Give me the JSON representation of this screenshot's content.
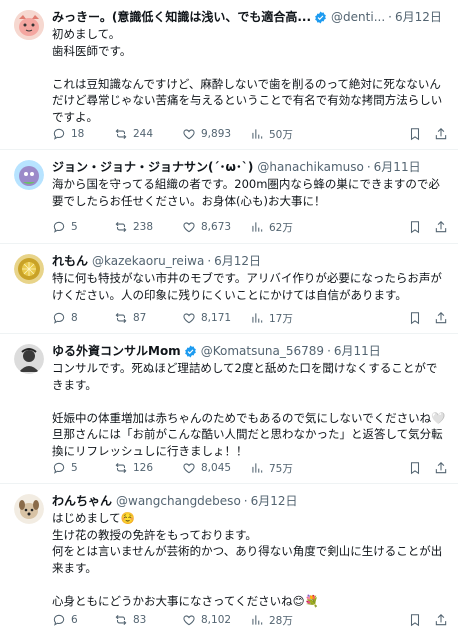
{
  "posts": [
    {
      "name": "みっきー。(意識低く知識は浅い、でも適合高...",
      "handle": "@denti...",
      "date": "6月12日",
      "text": "初めまして。\n歯科医師です。\n\nこれは豆知識なんですけど、麻酔しないで歯を削るのって絶対に死なないんだけど尋常じゃない苦痛を与えるということで有名で有効な拷問方法らしいですよ。",
      "replies": "18",
      "reposts": "244",
      "likes": "9,893",
      "views": "50万",
      "avatar_color": "#f4a6a0",
      "verified": true
    },
    {
      "name": "ジョン・ジョナ・ジョナサン(´･ω･`)",
      "handle": "@hanachikamuso",
      "date": "6月11日",
      "text": "海から国を守ってる組織の者です。200m圏内なら蜂の巣にできますので必要でしたらお任せください。お身体(心も)お大事に！",
      "replies": "5",
      "reposts": "238",
      "likes": "8,673",
      "views": "62万",
      "avatar_color": "#9b8ac9",
      "verified": false
    },
    {
      "name": "れもん",
      "handle": "@kazekaoru_reiwa",
      "date": "6月12日",
      "text": "特に何も特技がない市井のモブです。アリバイ作りが必要になったらお声がけください。人の印象に残りにくいことにかけては自信があります。",
      "replies": "8",
      "reposts": "87",
      "likes": "8,171",
      "views": "17万",
      "avatar_color": "#c9a227",
      "verified": false
    },
    {
      "name": "ゆる外資コンサルMom",
      "handle": "@Komatsuna_56789",
      "date": "6月11日",
      "text": "コンサルです。死ぬほど理詰めして2度と舐めた口を聞けなくすることができます。\n\n妊娠中の体重増加は赤ちゃんのためでもあるので気にしないでくださいね🤍\n旦那さんには「お前がこんな酷い人間だと思わなかった」と返答して気分転換にリフレッシュしに行きましょ！！",
      "replies": "5",
      "reposts": "126",
      "likes": "8,045",
      "views": "75万",
      "avatar_color": "#3a3a3a",
      "verified": true
    },
    {
      "name": "わんちゃん",
      "handle": "@wangchangdebeso",
      "date": "6月12日",
      "text": "はじめまして☺️\n生け花の教授の免許をもっております。\n何をとは言いませんが芸術的かつ、あり得ない角度で剣山に生けることが出来ます。\n\n心身ともにどうかお大事になさってくださいね😊💐",
      "replies": "6",
      "reposts": "83",
      "likes": "8,102",
      "views": "28万",
      "avatar_color": "#d8c3a5",
      "verified": false
    }
  ],
  "colors": {
    "verified": "#1d9bf0",
    "muted": "#536471"
  },
  "icons": [
    "reply-icon",
    "repost-icon",
    "like-icon",
    "views-icon",
    "bookmark-icon",
    "share-icon",
    "more-icon",
    "verified-icon"
  ]
}
